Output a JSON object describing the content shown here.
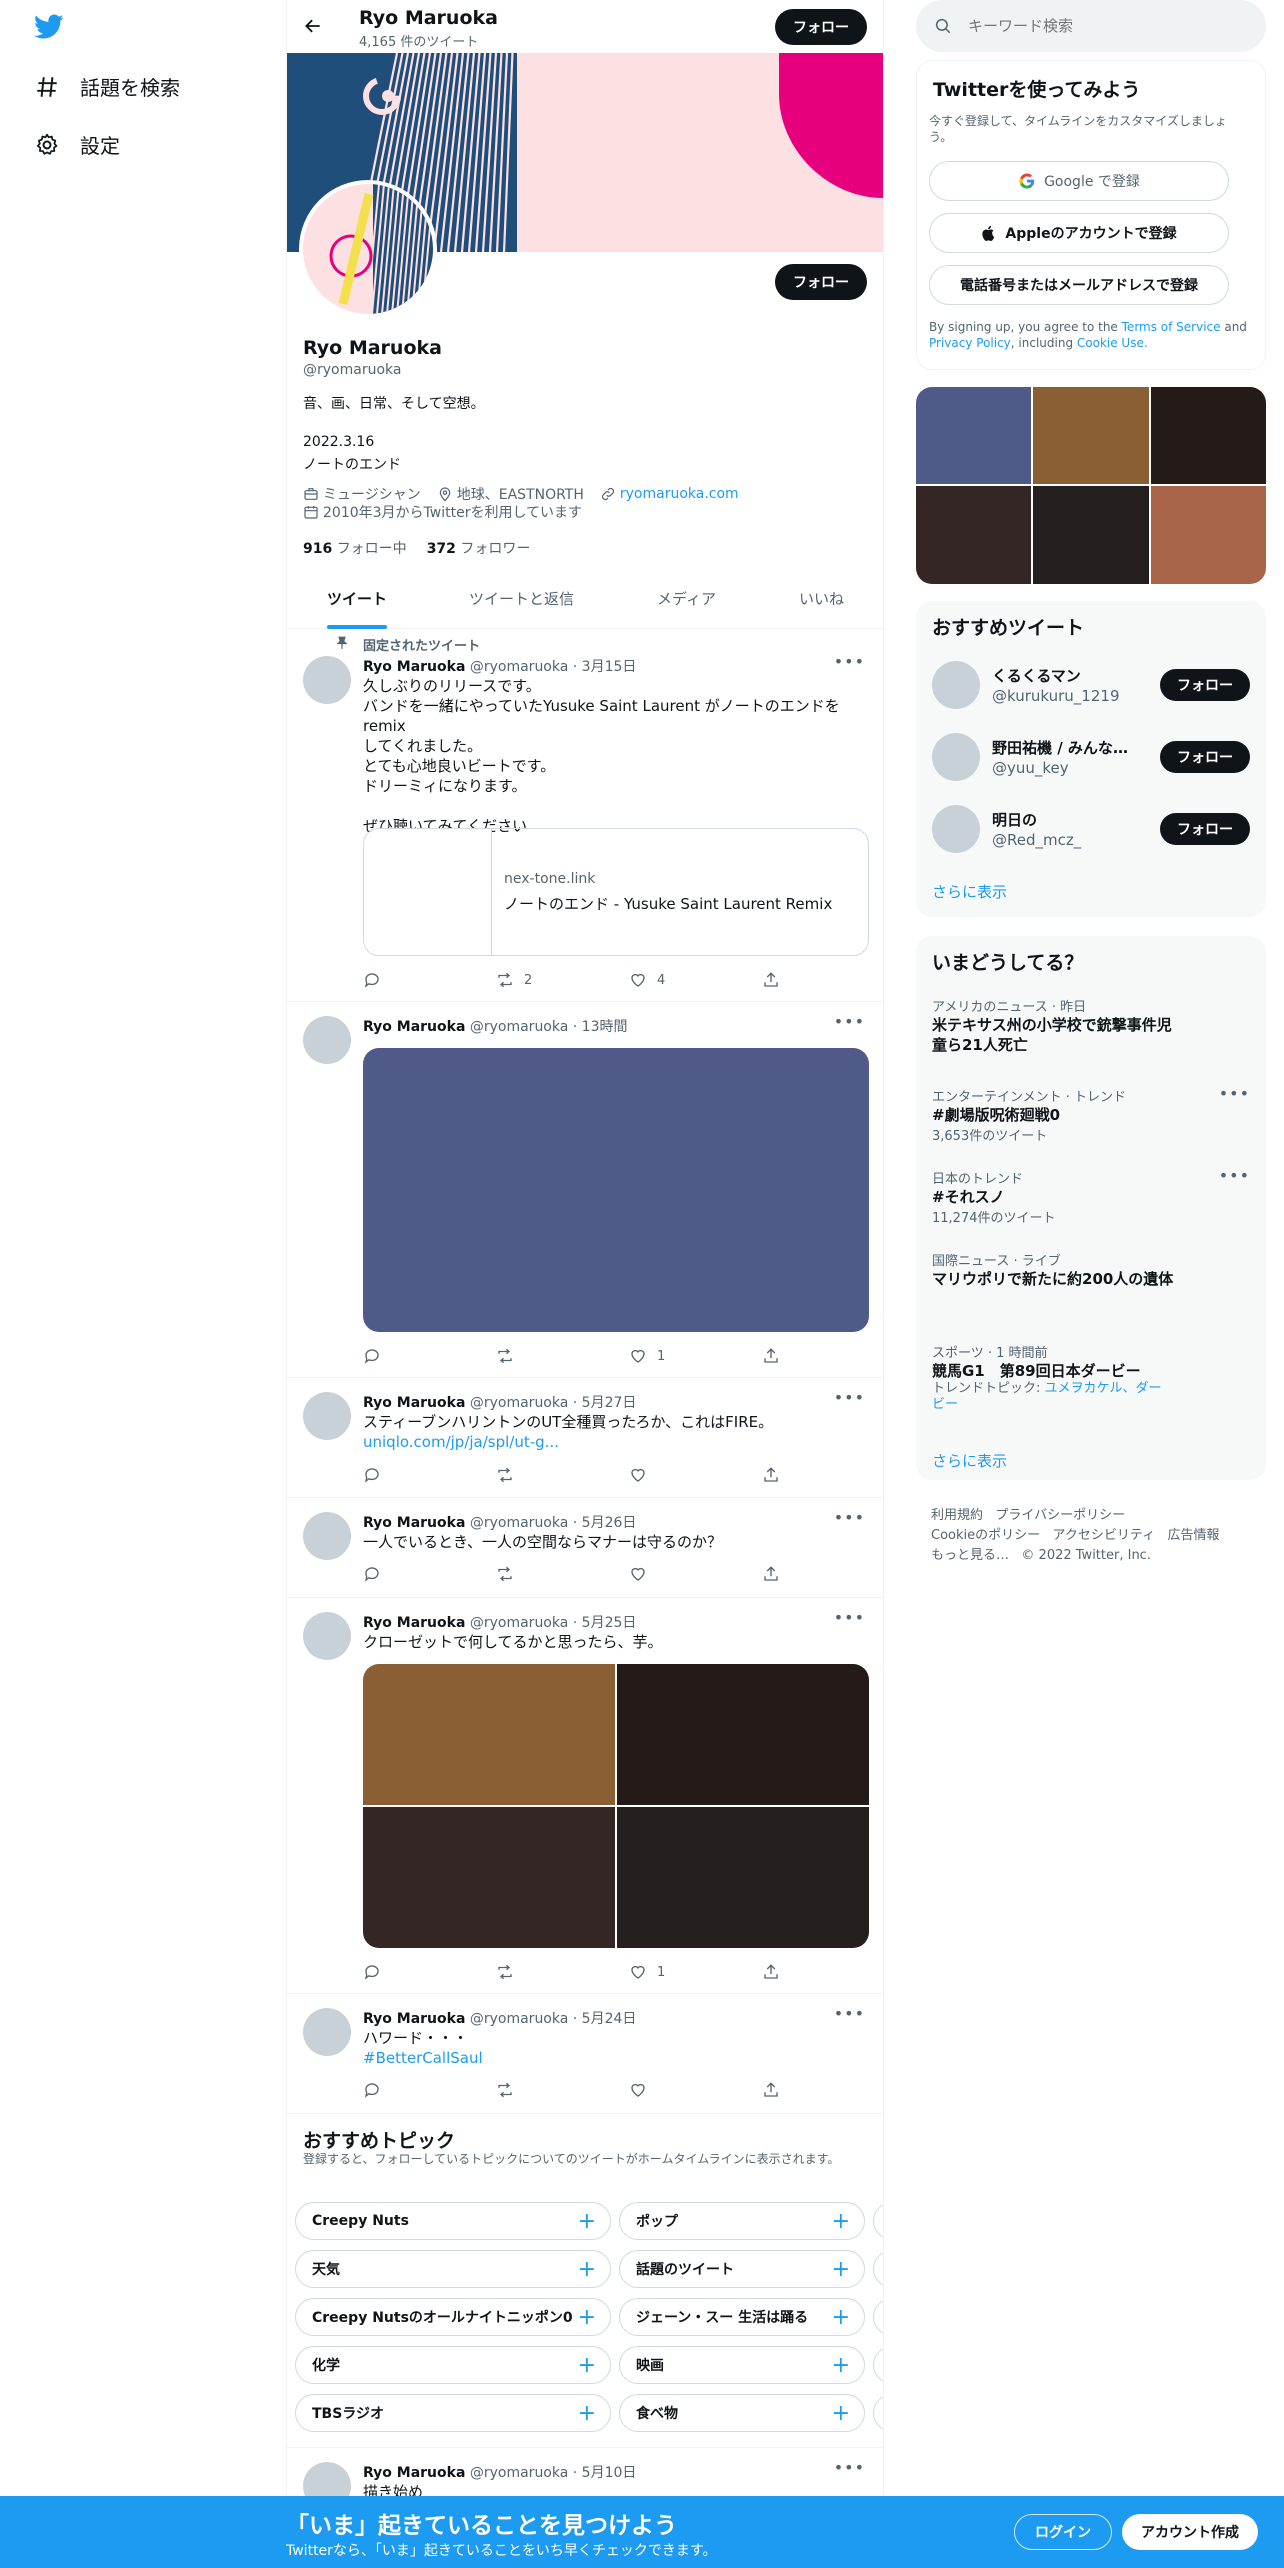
{
  "nav": {
    "explore": "話題を検索",
    "settings": "設定"
  },
  "header": {
    "name": "Ryo Maruoka",
    "tweet_count": "4,165 件のツイート",
    "follow": "フォロー"
  },
  "profile": {
    "follow": "フォロー",
    "name": "Ryo Maruoka",
    "handle": "@ryomaruoka",
    "bio1": "音、画、日常、そして空想。",
    "bio2": "2022.3.16",
    "bio3": "ノートのエンド",
    "occupation": "ミュージシャン",
    "location": "地球、EASTNORTH",
    "website": "ryomaruoka.com",
    "joined": "2010年3月からTwitterを利用しています",
    "following_count": "916",
    "following_label": "フォロー中",
    "followers_count": "372",
    "followers_label": "フォロワー"
  },
  "tabs": [
    "ツイート",
    "ツイートと返信",
    "メディア",
    "いいね"
  ],
  "pinned_label": "固定されたツイート",
  "tweets": [
    {
      "name": "Ryo Maruoka",
      "meta": "@ryomaruoka · 3月15日",
      "lines": [
        "久しぶりのリリースです。",
        "バンドを一緒にやっていたYusuke Saint  Laurent がノートのエンドをremix",
        "してくれました。",
        "とても心地良いビートです。",
        "ドリーミィになります。",
        "",
        "ぜひ聴いてみてください"
      ],
      "card_domain": "nex-tone.link",
      "card_title": "ノートのエンド - Yusuke Saint Laurent Remix",
      "retweets": "2",
      "likes": "4"
    },
    {
      "name": "Ryo Maruoka",
      "meta": "@ryomaruoka · 13時間",
      "likes": "1"
    },
    {
      "name": "Ryo Maruoka",
      "meta": "@ryomaruoka · 5月27日",
      "text": "スティーブンハリントンのUT全種買ったろか、これはFIRE。",
      "link": "uniqlo.com/jp/ja/spl/ut-g..."
    },
    {
      "name": "Ryo Maruoka",
      "meta": "@ryomaruoka · 5月26日",
      "text": "一人でいるとき、一人の空間ならマナーは守るのか？"
    },
    {
      "name": "Ryo Maruoka",
      "meta": "@ryomaruoka · 5月25日",
      "text": "クローゼットで何してるかと思ったら、芋。",
      "likes": "1"
    },
    {
      "name": "Ryo Maruoka",
      "meta": "@ryomaruoka · 5月24日",
      "text": "ハワード・・・",
      "hashtag": "#BetterCallSaul"
    },
    {
      "name": "Ryo Maruoka",
      "meta": "@ryomaruoka · 5月10日",
      "text": "描き始め"
    }
  ],
  "topics": {
    "title": "おすすめトピック",
    "subtitle": "登録すると、フォローしているトピックについてのツイートがホームタイムラインに表示されます。",
    "col1": [
      "Creepy Nuts",
      "天気",
      "Creepy Nutsのオールナイトニッポン0",
      "化学",
      "TBSラジオ"
    ],
    "col2": [
      "ポップ",
      "話題のツイート",
      "ジェーン・スー 生活は踊る",
      "映画",
      "食べ物"
    ]
  },
  "search": {
    "placeholder": "キーワード検索"
  },
  "signup": {
    "title": "Twitterを使ってみよう",
    "subtitle": "今すぐ登録して、タイムラインをカスタマイズしましょう。",
    "google": "Google で登録",
    "apple": "Appleのアカウントで登録",
    "phone": "電話番号またはメールアドレスで登録",
    "terms_pre": "By signing up, you agree to the ",
    "terms_link": "Terms of Service",
    "terms_mid": " and ",
    "privacy_link": "Privacy Policy",
    "terms_post": ", including ",
    "cookie_link": "Cookie Use."
  },
  "media_grid_colors": [
    "#505a88",
    "#8a5f33",
    "#241b18",
    "#332624",
    "#251f1d",
    "#a8654a"
  ],
  "suggested": {
    "title": "おすすめツイート",
    "users": [
      {
        "name": "くるくるマン",
        "handle": "@kurukuru_1219"
      },
      {
        "name": "野田祐機 / みんなシステム",
        "handle": "@yuu_key"
      },
      {
        "name": "明日の",
        "handle": "@Red_mcz_"
      }
    ],
    "follow": "フォロー",
    "more": "さらに表示"
  },
  "trends": {
    "title": "いまどうしてる？",
    "items": [
      {
        "category": "アメリカのニュース · 昨日",
        "title": "米テキサス州の小学校で銃撃事件児童ら21人死亡"
      },
      {
        "category": "エンターテインメント · トレンド",
        "title": "#劇場版呪術廻戦0",
        "count": "3,653件のツイート"
      },
      {
        "category": "日本のトレンド",
        "title": "#それスノ",
        "count": "11,274件のツイート"
      },
      {
        "category": "国際ニュース · ライブ",
        "title": "マリウポリで新たに約200人の遺体"
      },
      {
        "category": "スポーツ · 1 時間前",
        "title": "競馬G1　第89回日本ダービー",
        "topic_pre": "トレンドトピック: ",
        "topic": "ユメヲカケル、ダービー"
      }
    ],
    "more": "さらに表示"
  },
  "footer": {
    "terms": "利用規約",
    "privacy": "プライバシーポリシー",
    "cookie": "Cookieのポリシー",
    "accessibility": "アクセシビリティ",
    "ads": "広告情報",
    "more": "もっと見る…",
    "copyright": "© 2022 Twitter, Inc."
  },
  "bottom": {
    "title": "「いま」起きていることを見つけよう",
    "subtitle": "Twitterなら、「いま」起きていることをいち早くチェックできます。",
    "login": "ログイン",
    "signup": "アカウント作成"
  },
  "colors": {
    "accent": "#1d9bf0",
    "banner_navy": "#1f4e7a",
    "banner_pink": "#fde0e2",
    "banner_magenta": "#e6007e",
    "tweet_image": "#505a88"
  },
  "icons": [
    "twitter-logo-icon",
    "hashtag-icon",
    "gear-icon",
    "back-arrow-icon",
    "search-icon",
    "pin-icon",
    "reply-icon",
    "retweet-icon",
    "like-icon",
    "share-icon",
    "calendar-icon",
    "location-icon",
    "link-icon",
    "briefcase-icon",
    "google-icon",
    "apple-icon",
    "more-icon"
  ]
}
